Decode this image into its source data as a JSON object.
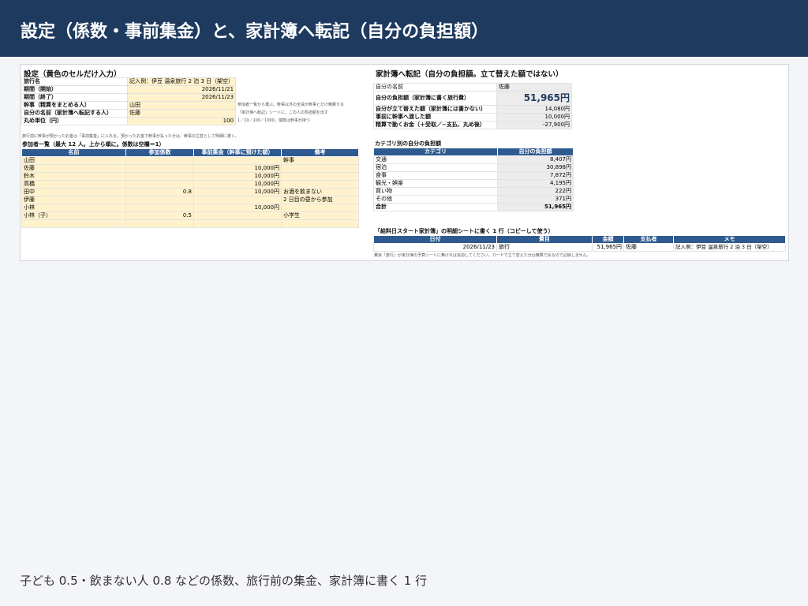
{
  "header": {
    "title": "設定（係数・事前集金）と、家計簿へ転記（自分の負担額）"
  },
  "caption": "子ども 0.5・飲まない人 0.8 などの係数、旅行前の集金、家計簿に書く 1 行",
  "settings": {
    "title": "設定（黄色のセルだけ入力）",
    "rows": [
      {
        "label": "旅行名",
        "value": "記入例：伊豆 温泉旅行 2 泊 3 日（架空）",
        "note": ""
      },
      {
        "label": "期間（開始）",
        "value": "2026/11/21",
        "note": ""
      },
      {
        "label": "期間（終了）",
        "value": "2026/11/23",
        "note": ""
      },
      {
        "label": "幹事（精算をまとめる人）",
        "value": "山田",
        "note": "参加者一覧から選ぶ。幹事以外の全員が幹事とだけ精算する"
      },
      {
        "label": "自分の名前（家計簿へ転記する人）",
        "value": "佐藤",
        "note": "「家計簿へ転記」シートに、この人の負担額を出す"
      },
      {
        "label": "丸め単位（円）",
        "value": "100",
        "note": "1／10／100／1000。端数は幹事が持つ"
      }
    ],
    "footnote": "旅行前に幹事が預かったお金は「事前集金」に入れる。預かったお金で幹事が払った分は、幹事の立替として明細に書く。"
  },
  "participants": {
    "title": "参加者一覧（最大 12 人。上から順に。係数は空欄＝1）",
    "headers": [
      "名前",
      "参加係数",
      "事前集金（幹事に預けた額）",
      "備考"
    ],
    "rows": [
      [
        "山田",
        "",
        "",
        "幹事"
      ],
      [
        "佐藤",
        "",
        "10,000円",
        ""
      ],
      [
        "鈴木",
        "",
        "10,000円",
        ""
      ],
      [
        "高橋",
        "",
        "10,000円",
        ""
      ],
      [
        "田中",
        "0.8",
        "10,000円",
        "お酒を飲まない"
      ],
      [
        "伊藤",
        "",
        "",
        "2 日目の昼から参加"
      ],
      [
        "小林",
        "",
        "10,000円",
        ""
      ],
      [
        "小林（子）",
        "0.5",
        "",
        "小学生"
      ],
      [
        "",
        "",
        "",
        ""
      ]
    ]
  },
  "kakeibo": {
    "title": "家計簿へ転記（自分の負担額。立て替えた額ではない）",
    "name_label": "自分の名前",
    "name_value": "佐藤",
    "burden_label": "自分の負担額（家計簿に書く旅行費）",
    "burden_value": "51,965円",
    "rows": [
      {
        "label": "自分が立て替えた額（家計簿には書かない）",
        "value": "14,080円"
      },
      {
        "label": "事前に幹事へ渡した額",
        "value": "10,000円"
      },
      {
        "label": "精算で動くお金（＋受取／−支払、丸め後）",
        "value": "-27,900円"
      }
    ]
  },
  "category": {
    "title": "カテゴリ別の自分の負担額",
    "headers": [
      "カテゴリ",
      "自分の負担額"
    ],
    "rows": [
      [
        "交通",
        "8,407円"
      ],
      [
        "宿泊",
        "30,898円"
      ],
      [
        "食事",
        "7,872円"
      ],
      [
        "観光・娯楽",
        "4,195円"
      ],
      [
        "買い物",
        "222円"
      ],
      [
        "その他",
        "371円"
      ]
    ],
    "total_label": "合計",
    "total_value": "51,965円"
  },
  "ledger": {
    "title": "「給料日スタート家計簿」の明細シートに書く 1 行（コピーして使う）",
    "headers": [
      "日付",
      "費目",
      "金額",
      "支払者",
      "メモ"
    ],
    "row": [
      "2026/11/23",
      "旅行",
      "51,965円",
      "佐藤",
      "記入例：伊豆 温泉旅行 2 泊 3 日（架空）"
    ],
    "footnote": "費目「旅行」が家計簿の予算シートに無ければ追加してください。カードで立て替えた分は精算で戻るので記録しません。"
  }
}
